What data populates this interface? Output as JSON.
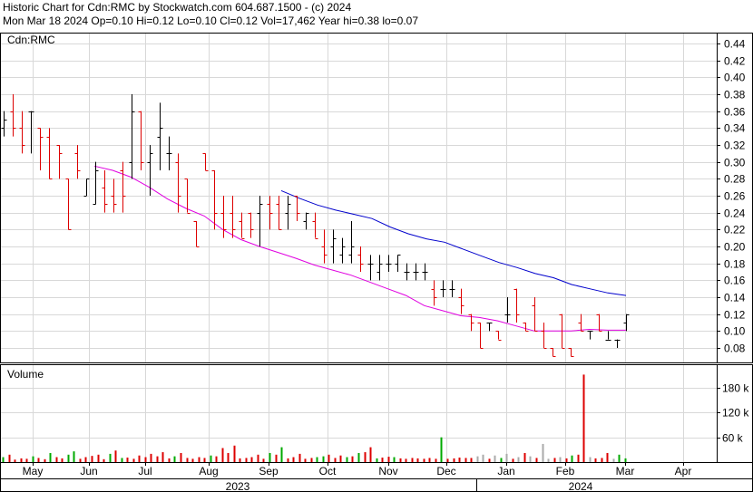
{
  "header": {
    "line1": "Historic Chart for Cdn:RMC by Stockwatch.com 604.687.1500 - (c) 2024",
    "line2": "Mon Mar 18 2024  Op=0.10  Hi=0.12  Lo=0.10  Cl=0.12  Vol=17,462  Year hi=0.38  lo=0.07"
  },
  "colors": {
    "up": "#000000",
    "down": "#dd0000",
    "ma_short": "#e000e0",
    "ma_long": "#0000cc",
    "grid": "#d8d8d8",
    "vol_up": "#00aa00",
    "vol_down": "#dd0000",
    "vol_gray": "#aaaaaa"
  },
  "chart_data": [
    {
      "type": "ohlc",
      "symbol_label": "Cdn:RMC",
      "ylim": [
        0.06,
        0.46
      ],
      "y_ticks": [
        "0.44",
        "0.42",
        "0.40",
        "0.38",
        "0.36",
        "0.34",
        "0.32",
        "0.30",
        "0.28",
        "0.26",
        "0.24",
        "0.22",
        "0.20",
        "0.18",
        "0.16",
        "0.14",
        "0.12",
        "0.10",
        "0.08"
      ],
      "x_months": [
        "May",
        "Jun",
        "Jul",
        "Aug",
        "Sep",
        "Oct",
        "Nov",
        "Dec",
        "Jan",
        "Feb",
        "Mar",
        "Apr"
      ],
      "x_years": [
        "2023",
        "2024"
      ],
      "bars": [
        [
          0.34,
          0.36,
          0.33,
          0.35
        ],
        [
          0.36,
          0.38,
          0.33,
          0.34
        ],
        [
          0.34,
          0.36,
          0.31,
          0.32
        ],
        [
          0.36,
          0.36,
          0.31,
          0.36
        ],
        [
          0.34,
          0.34,
          0.29,
          0.33
        ],
        [
          0.33,
          0.34,
          0.28,
          0.28
        ],
        [
          0.32,
          0.32,
          0.28,
          0.31
        ],
        [
          0.28,
          0.28,
          0.22,
          0.22
        ],
        [
          0.31,
          0.32,
          0.28,
          0.29
        ],
        [
          0.26,
          0.28,
          0.26,
          0.28
        ],
        [
          0.25,
          0.3,
          0.25,
          0.29
        ],
        [
          0.27,
          0.29,
          0.24,
          0.25
        ],
        [
          0.26,
          0.28,
          0.24,
          0.25
        ],
        [
          0.29,
          0.3,
          0.24,
          0.26
        ],
        [
          0.3,
          0.38,
          0.28,
          0.36
        ],
        [
          0.36,
          0.36,
          0.29,
          0.3
        ],
        [
          0.3,
          0.32,
          0.26,
          0.31
        ],
        [
          0.33,
          0.37,
          0.29,
          0.34
        ],
        [
          0.31,
          0.33,
          0.29,
          0.31
        ],
        [
          0.3,
          0.31,
          0.24,
          0.26
        ],
        [
          0.28,
          0.28,
          0.24,
          0.24
        ],
        [
          0.23,
          0.23,
          0.2,
          0.2
        ],
        [
          0.31,
          0.31,
          0.29,
          0.29
        ],
        [
          0.29,
          0.29,
          0.22,
          0.24
        ],
        [
          0.24,
          0.26,
          0.21,
          0.22
        ],
        [
          0.24,
          0.26,
          0.21,
          0.22
        ],
        [
          0.23,
          0.24,
          0.21,
          0.21
        ],
        [
          0.24,
          0.24,
          0.21,
          0.22
        ],
        [
          0.24,
          0.26,
          0.2,
          0.25
        ],
        [
          0.25,
          0.26,
          0.22,
          0.24
        ],
        [
          0.25,
          0.26,
          0.22,
          0.22
        ],
        [
          0.24,
          0.26,
          0.22,
          0.25
        ],
        [
          0.26,
          0.26,
          0.23,
          0.24
        ],
        [
          0.23,
          0.24,
          0.22,
          0.24
        ],
        [
          0.23,
          0.24,
          0.21,
          0.21
        ],
        [
          0.2,
          0.22,
          0.18,
          0.19
        ],
        [
          0.2,
          0.22,
          0.18,
          0.21
        ],
        [
          0.19,
          0.21,
          0.18,
          0.2
        ],
        [
          0.19,
          0.23,
          0.18,
          0.2
        ],
        [
          0.19,
          0.2,
          0.17,
          0.18
        ],
        [
          0.18,
          0.19,
          0.16,
          0.18
        ],
        [
          0.17,
          0.19,
          0.16,
          0.18
        ],
        [
          0.18,
          0.19,
          0.17,
          0.18
        ],
        [
          0.18,
          0.19,
          0.17,
          0.19
        ],
        [
          0.17,
          0.18,
          0.16,
          0.17
        ],
        [
          0.17,
          0.18,
          0.16,
          0.17
        ],
        [
          0.17,
          0.18,
          0.16,
          0.17
        ],
        [
          0.15,
          0.16,
          0.13,
          0.14
        ],
        [
          0.15,
          0.16,
          0.14,
          0.15
        ],
        [
          0.15,
          0.16,
          0.14,
          0.15
        ],
        [
          0.14,
          0.15,
          0.12,
          0.13
        ],
        [
          0.12,
          0.12,
          0.1,
          0.11
        ],
        [
          0.11,
          0.11,
          0.08,
          0.08
        ],
        [
          0.11,
          0.11,
          0.1,
          0.11
        ],
        [
          0.1,
          0.1,
          0.09,
          0.09
        ],
        [
          0.12,
          0.14,
          0.11,
          0.12
        ],
        [
          0.15,
          0.15,
          0.11,
          0.12
        ],
        [
          0.11,
          0.11,
          0.1,
          0.1
        ],
        [
          0.13,
          0.14,
          0.1,
          0.1
        ],
        [
          0.1,
          0.11,
          0.08,
          0.08
        ],
        [
          0.08,
          0.08,
          0.07,
          0.07
        ],
        [
          0.12,
          0.12,
          0.08,
          0.08
        ],
        [
          0.08,
          0.08,
          0.07,
          0.07
        ],
        [
          0.11,
          0.12,
          0.1,
          0.1
        ],
        [
          0.1,
          0.1,
          0.09,
          0.1
        ],
        [
          0.12,
          0.12,
          0.1,
          0.1
        ],
        [
          0.09,
          0.1,
          0.09,
          0.09
        ],
        [
          0.09,
          0.09,
          0.08,
          0.09
        ],
        [
          0.11,
          0.12,
          0.1,
          0.12
        ]
      ],
      "ma_short": [
        [
          0.3,
          0.295
        ],
        [
          0.29,
          0.29
        ],
        [
          0.28,
          0.282
        ],
        [
          0.27,
          0.27
        ],
        [
          0.26,
          0.256
        ],
        [
          0.25,
          0.245
        ],
        [
          0.24,
          0.236
        ],
        [
          0.23,
          0.22
        ],
        [
          0.22,
          0.208
        ],
        [
          0.21,
          0.2
        ],
        [
          0.2,
          0.193
        ],
        [
          0.19,
          0.186
        ],
        [
          0.18,
          0.178
        ],
        [
          0.17,
          0.172
        ],
        [
          0.16,
          0.166
        ],
        [
          0.15,
          0.158
        ],
        [
          0.14,
          0.15
        ],
        [
          0.13,
          0.142
        ],
        [
          0.12,
          0.13
        ],
        [
          0.11,
          0.124
        ],
        [
          0.1,
          0.118
        ],
        [
          0.09,
          0.116
        ],
        [
          0.08,
          0.112
        ],
        [
          0.07,
          0.106
        ],
        [
          0.06,
          0.1
        ],
        [
          0.05,
          0.1
        ],
        [
          0.04,
          0.1
        ],
        [
          0.03,
          0.102
        ],
        [
          0.02,
          0.101
        ],
        [
          0.01,
          0.101
        ]
      ],
      "ma_long": [
        [
          0.26,
          0.266
        ],
        [
          0.24,
          0.257
        ],
        [
          0.22,
          0.249
        ],
        [
          0.2,
          0.243
        ],
        [
          0.18,
          0.238
        ],
        [
          0.16,
          0.233
        ],
        [
          0.14,
          0.223
        ],
        [
          0.12,
          0.215
        ],
        [
          0.1,
          0.209
        ],
        [
          0.08,
          0.205
        ],
        [
          0.06,
          0.197
        ],
        [
          0.04,
          0.189
        ],
        [
          0.02,
          0.181
        ],
        [
          0.0,
          0.175
        ],
        [
          -0.02,
          0.168
        ],
        [
          -0.04,
          0.163
        ],
        [
          -0.06,
          0.155
        ],
        [
          -0.08,
          0.15
        ],
        [
          -0.1,
          0.145
        ],
        [
          -0.12,
          0.142
        ]
      ]
    },
    {
      "type": "bar",
      "title": "Volume",
      "ylim": [
        0,
        225
      ],
      "y_ticks": [
        "180 k",
        "120 k",
        "60 k"
      ],
      "values": [
        [
          12,
          "g"
        ],
        [
          18,
          "r"
        ],
        [
          6,
          "r"
        ],
        [
          9,
          "r"
        ],
        [
          8,
          "r"
        ],
        [
          14,
          "g"
        ],
        [
          10,
          "r"
        ],
        [
          7,
          "r"
        ],
        [
          22,
          "g"
        ],
        [
          12,
          "r"
        ],
        [
          9,
          "r"
        ],
        [
          18,
          "g"
        ],
        [
          26,
          "g"
        ],
        [
          8,
          "r"
        ],
        [
          12,
          "r"
        ],
        [
          15,
          "r"
        ],
        [
          18,
          "r"
        ],
        [
          7,
          "r"
        ],
        [
          20,
          "g"
        ],
        [
          28,
          "r"
        ],
        [
          10,
          "g"
        ],
        [
          11,
          "r"
        ],
        [
          8,
          "r"
        ],
        [
          16,
          "r"
        ],
        [
          12,
          "r"
        ],
        [
          20,
          "r"
        ],
        [
          14,
          "r"
        ],
        [
          24,
          "r"
        ],
        [
          9,
          "r"
        ],
        [
          14,
          "g"
        ],
        [
          22,
          "r"
        ],
        [
          10,
          "r"
        ],
        [
          8,
          "r"
        ],
        [
          12,
          "r"
        ],
        [
          10,
          "r"
        ],
        [
          16,
          "g"
        ],
        [
          14,
          "r"
        ],
        [
          34,
          "r"
        ],
        [
          22,
          "r"
        ],
        [
          40,
          "r"
        ],
        [
          9,
          "r"
        ],
        [
          10,
          "r"
        ],
        [
          12,
          "r"
        ],
        [
          18,
          "r"
        ],
        [
          8,
          "r"
        ],
        [
          22,
          "g"
        ],
        [
          18,
          "r"
        ],
        [
          36,
          "g"
        ],
        [
          9,
          "r"
        ],
        [
          12,
          "r"
        ],
        [
          20,
          "r"
        ],
        [
          8,
          "r"
        ],
        [
          10,
          "r"
        ],
        [
          12,
          "g"
        ],
        [
          14,
          "g"
        ],
        [
          18,
          "r"
        ],
        [
          10,
          "r"
        ],
        [
          16,
          "r"
        ],
        [
          12,
          "g"
        ],
        [
          14,
          "r"
        ],
        [
          22,
          "g"
        ],
        [
          24,
          "r"
        ],
        [
          36,
          "r"
        ],
        [
          9,
          "g"
        ],
        [
          11,
          "r"
        ],
        [
          13,
          "r"
        ],
        [
          12,
          "g"
        ],
        [
          9,
          "r"
        ],
        [
          8,
          "r"
        ],
        [
          10,
          "r"
        ],
        [
          9,
          "r"
        ],
        [
          8,
          "r"
        ],
        [
          10,
          "r"
        ],
        [
          8,
          "r"
        ],
        [
          60,
          "g"
        ],
        [
          8,
          "r"
        ],
        [
          9,
          "r"
        ],
        [
          11,
          "r"
        ],
        [
          10,
          "r"
        ],
        [
          10,
          "r"
        ],
        [
          14,
          "a"
        ],
        [
          18,
          "a"
        ],
        [
          8,
          "r"
        ],
        [
          16,
          "a"
        ],
        [
          10,
          "g"
        ],
        [
          20,
          "a"
        ],
        [
          8,
          "r"
        ],
        [
          12,
          "a"
        ],
        [
          22,
          "r"
        ],
        [
          14,
          "a"
        ],
        [
          10,
          "r"
        ],
        [
          44,
          "a"
        ],
        [
          8,
          "a"
        ],
        [
          10,
          "r"
        ],
        [
          12,
          "a"
        ],
        [
          9,
          "r"
        ],
        [
          16,
          "g"
        ],
        [
          18,
          "r"
        ],
        [
          212,
          "r"
        ],
        [
          12,
          "a"
        ],
        [
          9,
          "r"
        ],
        [
          10,
          "r"
        ],
        [
          22,
          "r"
        ],
        [
          8,
          "a"
        ],
        [
          18,
          "g"
        ],
        [
          9,
          "g"
        ]
      ]
    }
  ]
}
